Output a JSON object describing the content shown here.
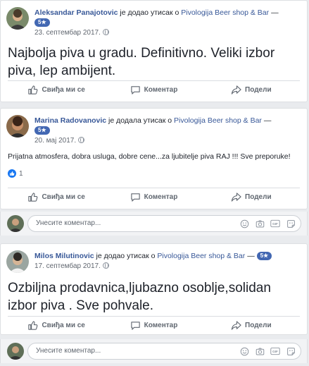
{
  "reviews": [
    {
      "author": "Aleksandar Panajotovic",
      "action": "је додао утисак о",
      "page": "Pivologija Beer shop & Bar",
      "dash": "—",
      "rating": "5★",
      "date": "23. септембар 2017.",
      "text": "Najbolja piva u gradu. Definitivno. Veliki izbor piva, lep ambijent."
    },
    {
      "author": "Marina Radovanovic",
      "action": "је додала утисак о",
      "page": "Pivologija Beer shop & Bar",
      "dash": "—",
      "rating": "5★",
      "date": "20. мај 2017.",
      "text": "Prijatna atmosfera, dobra usluga, dobre cene...za ljubitelje piva RAJ !!! Sve preporuke!",
      "likes": "1"
    },
    {
      "author": "Milos Milutinovic",
      "action": "је додао утисак о",
      "page": "Pivologija Beer shop & Bar",
      "dash": "—",
      "rating": "5★",
      "date": "17. септембар 2017.",
      "text": "Ozbiljna prodavnica,ljubazno osoblje,solidan izbor piva . Sve pohvale."
    }
  ],
  "actions": {
    "like": "Свиђа ми се",
    "comment": "Коментар",
    "share": "Подели"
  },
  "comment_box": {
    "placeholder": "Унесите коментар..."
  },
  "colors": {
    "link": "#385898",
    "badge": "#4267b2",
    "like_badge": "#1877f2"
  }
}
